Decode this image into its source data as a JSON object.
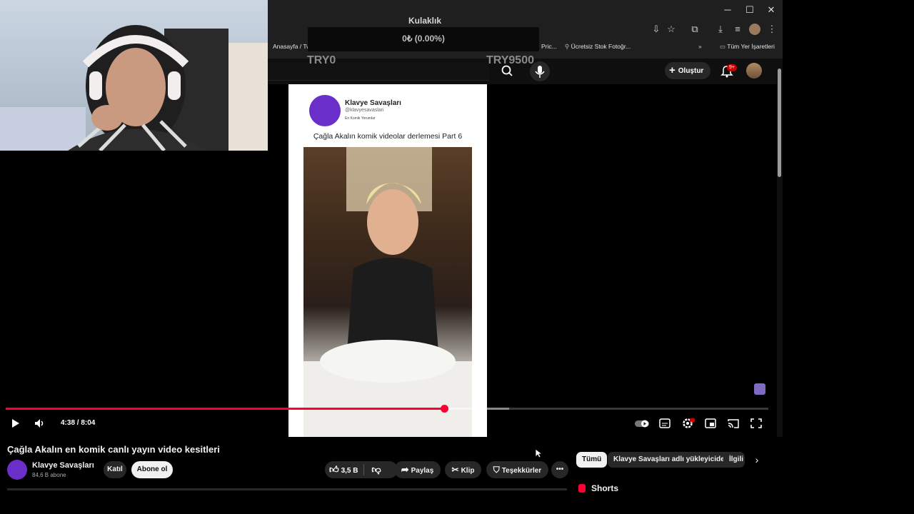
{
  "overlay": {
    "alert_title": "Kulaklık",
    "alert_amount": "0₺ (0.00%)",
    "goal_min": "TRY0",
    "goal_max": "TRY9500"
  },
  "browser": {
    "bookmarks": [
      "Anasayfa / Tw",
      "Pric...",
      "Ücretsiz Stok Fotoğr...",
      "Tüm Yer İşaretleri"
    ],
    "more_bookmarks_icon": "double-chevron-right-icon"
  },
  "youtube": {
    "create_label": "Oluştur",
    "notification_count": "9+"
  },
  "video_card": {
    "channel": "Klavye Savaşları",
    "handle": "@klavyesavaslari",
    "tagline": "En Komik Yorumlar",
    "caption": "Çağla Akalın komik videolar derlemesi Part 6"
  },
  "player": {
    "time": "4:38 / 8:04",
    "progress_fraction": 0.575,
    "buffer_fraction": 0.66
  },
  "video": {
    "title": "Çağla Akalın en komik canlı yayın video kesitleri",
    "channel_name": "Klavye Savaşları",
    "subscribers": "84,6 B abone",
    "join_label": "Katıl",
    "subscribe_label": "Abone ol",
    "likes": "3,5 B",
    "share_label": "Paylaş",
    "clip_label": "Klip",
    "thanks_label": "Teşekkürler"
  },
  "chips": {
    "all": "Tümü",
    "uploader": "Klavye Savaşları adlı yükleyiciden",
    "related": "İlgili"
  },
  "sidebar": {
    "shorts_label": "Shorts"
  }
}
